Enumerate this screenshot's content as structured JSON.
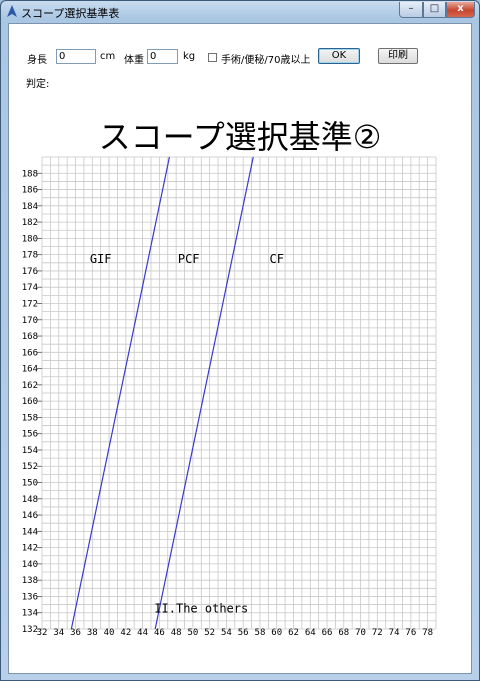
{
  "window": {
    "title": "スコープ選択基準表",
    "controls": {
      "minimize": "–",
      "maximize": "□",
      "close": "x"
    }
  },
  "form": {
    "height_label": "身長",
    "height_value": "0",
    "height_unit": "cm",
    "weight_label": "体重",
    "weight_value": "0",
    "weight_unit": "kg",
    "checkbox_label": "手術/便秘/70歳以上",
    "checkbox_checked": false,
    "ok_label": "OK",
    "print_label": "印刷",
    "judgement_label": "判定:"
  },
  "heading": "スコープ選択基準②",
  "chart_data": {
    "type": "line",
    "xlim": [
      32,
      79
    ],
    "ylim": [
      132,
      190
    ],
    "x_ticks": [
      32,
      34,
      36,
      38,
      40,
      42,
      44,
      46,
      48,
      50,
      52,
      54,
      56,
      58,
      60,
      62,
      64,
      66,
      68,
      70,
      72,
      74,
      76,
      78
    ],
    "y_ticks": [
      132,
      134,
      136,
      138,
      140,
      142,
      144,
      146,
      148,
      150,
      152,
      154,
      156,
      158,
      160,
      162,
      164,
      166,
      168,
      170,
      172,
      174,
      176,
      178,
      180,
      182,
      184,
      186,
      188
    ],
    "grid": true,
    "series": [
      {
        "values": [
          [
            35.5,
            132
          ],
          [
            47.2,
            190
          ]
        ]
      },
      {
        "values": [
          [
            45.5,
            132
          ],
          [
            57.2,
            190
          ]
        ]
      }
    ],
    "region_labels": [
      {
        "text": "GIF",
        "x": 39,
        "y": 177
      },
      {
        "text": "PCF",
        "x": 49.5,
        "y": 177
      },
      {
        "text": "CF",
        "x": 60,
        "y": 177
      },
      {
        "text": "II.The others",
        "x": 51,
        "y": 134
      }
    ],
    "line_color": "#3a3ad0"
  }
}
